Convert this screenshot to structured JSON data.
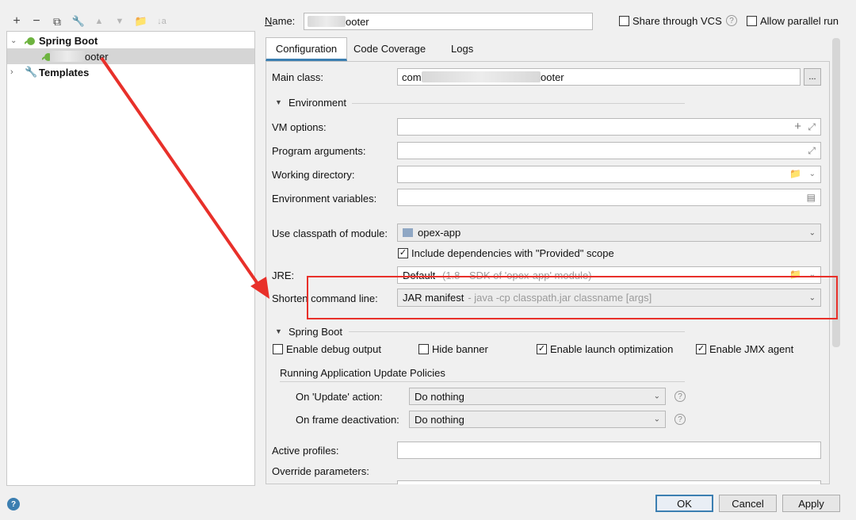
{
  "toolbar": {
    "add": "+",
    "remove": "−",
    "copy": "⧉",
    "edit": "🔧",
    "up": "▲",
    "down": "▼",
    "folder": "📁",
    "sort": "↓a"
  },
  "tree": {
    "spring_boot": "Spring Boot",
    "config_item_suffix": "ooter",
    "templates": "Templates"
  },
  "name_field": {
    "label": "Name:",
    "value_suffix": "ooter"
  },
  "share_vcs": "Share through VCS",
  "allow_parallel": "Allow parallel run",
  "tabs": [
    "Configuration",
    "Code Coverage",
    "Logs"
  ],
  "main_class": {
    "label": "Main class:",
    "value_prefix": "com",
    "value_suffix": "ooter",
    "browse": "..."
  },
  "environment": {
    "header": "Environment",
    "vm_options": "VM options:",
    "program_arguments": "Program arguments:",
    "working_directory": "Working directory:",
    "environment_variables": "Environment variables:"
  },
  "classpath": {
    "label": "Use classpath of module:",
    "value": "opex-app",
    "include_provided": "Include dependencies with \"Provided\" scope"
  },
  "jre": {
    "label": "JRE:",
    "value": "Default",
    "hint": "(1.8 - SDK of 'opex-app' module)"
  },
  "shorten": {
    "label": "Shorten command line:",
    "value": "JAR manifest",
    "hint": "- java -cp classpath.jar classname [args]"
  },
  "spring_boot": {
    "header": "Spring Boot",
    "debug_output": "Enable debug output",
    "hide_banner": "Hide banner",
    "launch_optimization": "Enable launch optimization",
    "jmx_agent": "Enable JMX agent"
  },
  "update_policies": {
    "header": "Running Application Update Policies",
    "on_update_label": "On 'Update' action:",
    "on_update_value": "Do nothing",
    "on_frame_label": "On frame deactivation:",
    "on_frame_value": "Do nothing"
  },
  "active_profiles": "Active profiles:",
  "override_parameters": "Override parameters:",
  "buttons": {
    "ok": "OK",
    "cancel": "Cancel",
    "apply": "Apply"
  },
  "help_icon": "?",
  "accent": "#3c7fb1",
  "annotation_color": "#e8302a"
}
